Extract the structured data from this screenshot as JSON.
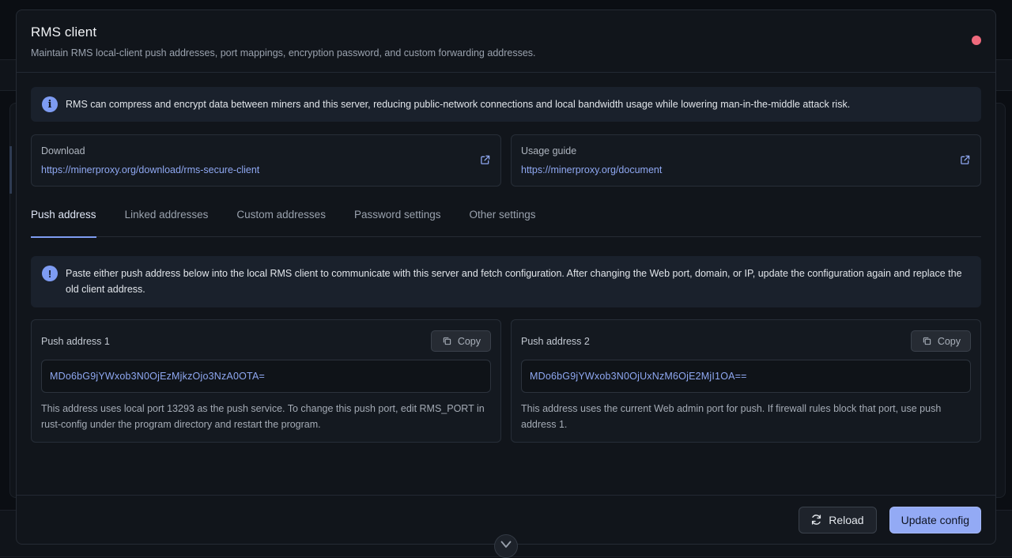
{
  "modal": {
    "title": "RMS client",
    "subtitle": "Maintain RMS local-client push addresses, port mappings, encryption password, and custom forwarding addresses."
  },
  "info_alert": {
    "icon": "info-icon",
    "text": "RMS can compress and encrypt data between miners and this server, reducing public-network connections and local bandwidth usage while lowering man-in-the-middle attack risk."
  },
  "links": [
    {
      "label": "Download",
      "url": "https://minerproxy.org/download/rms-secure-client",
      "icon": "external-link-icon"
    },
    {
      "label": "Usage guide",
      "url": "https://minerproxy.org/document",
      "icon": "external-link-icon"
    }
  ],
  "tabs": [
    {
      "label": "Push address",
      "active": true
    },
    {
      "label": "Linked addresses",
      "active": false
    },
    {
      "label": "Custom addresses",
      "active": false
    },
    {
      "label": "Password settings",
      "active": false
    },
    {
      "label": "Other settings",
      "active": false
    }
  ],
  "push_alert": {
    "icon": "exclamation-icon",
    "text": "Paste either push address below into the local RMS client to communicate with this server and fetch configuration. After changing the Web port, domain, or IP, update the configuration again and replace the old client address."
  },
  "push_addresses": [
    {
      "label": "Push address 1",
      "copy_label": "Copy",
      "value": "MDo6bG9jYWxob3N0OjEzMjkzOjo3NzA0OTA=",
      "description": "This address uses local port 13293 as the push service. To change this push port, edit RMS_PORT in rust-config under the program directory and restart the program."
    },
    {
      "label": "Push address 2",
      "copy_label": "Copy",
      "value": "MDo6bG9jYWxob3N0OjUxNzM6OjE2MjI1OA==",
      "description": "This address uses the current Web admin port for push. If firewall rules block that port, use push address 1."
    }
  ],
  "footer": {
    "reload_label": "Reload",
    "update_label": "Update config"
  },
  "colors": {
    "accent": "#7e9cf2",
    "primary_button": "#93aaf5",
    "close_dot": "#ef6a7d",
    "link": "#8fa8f2"
  }
}
